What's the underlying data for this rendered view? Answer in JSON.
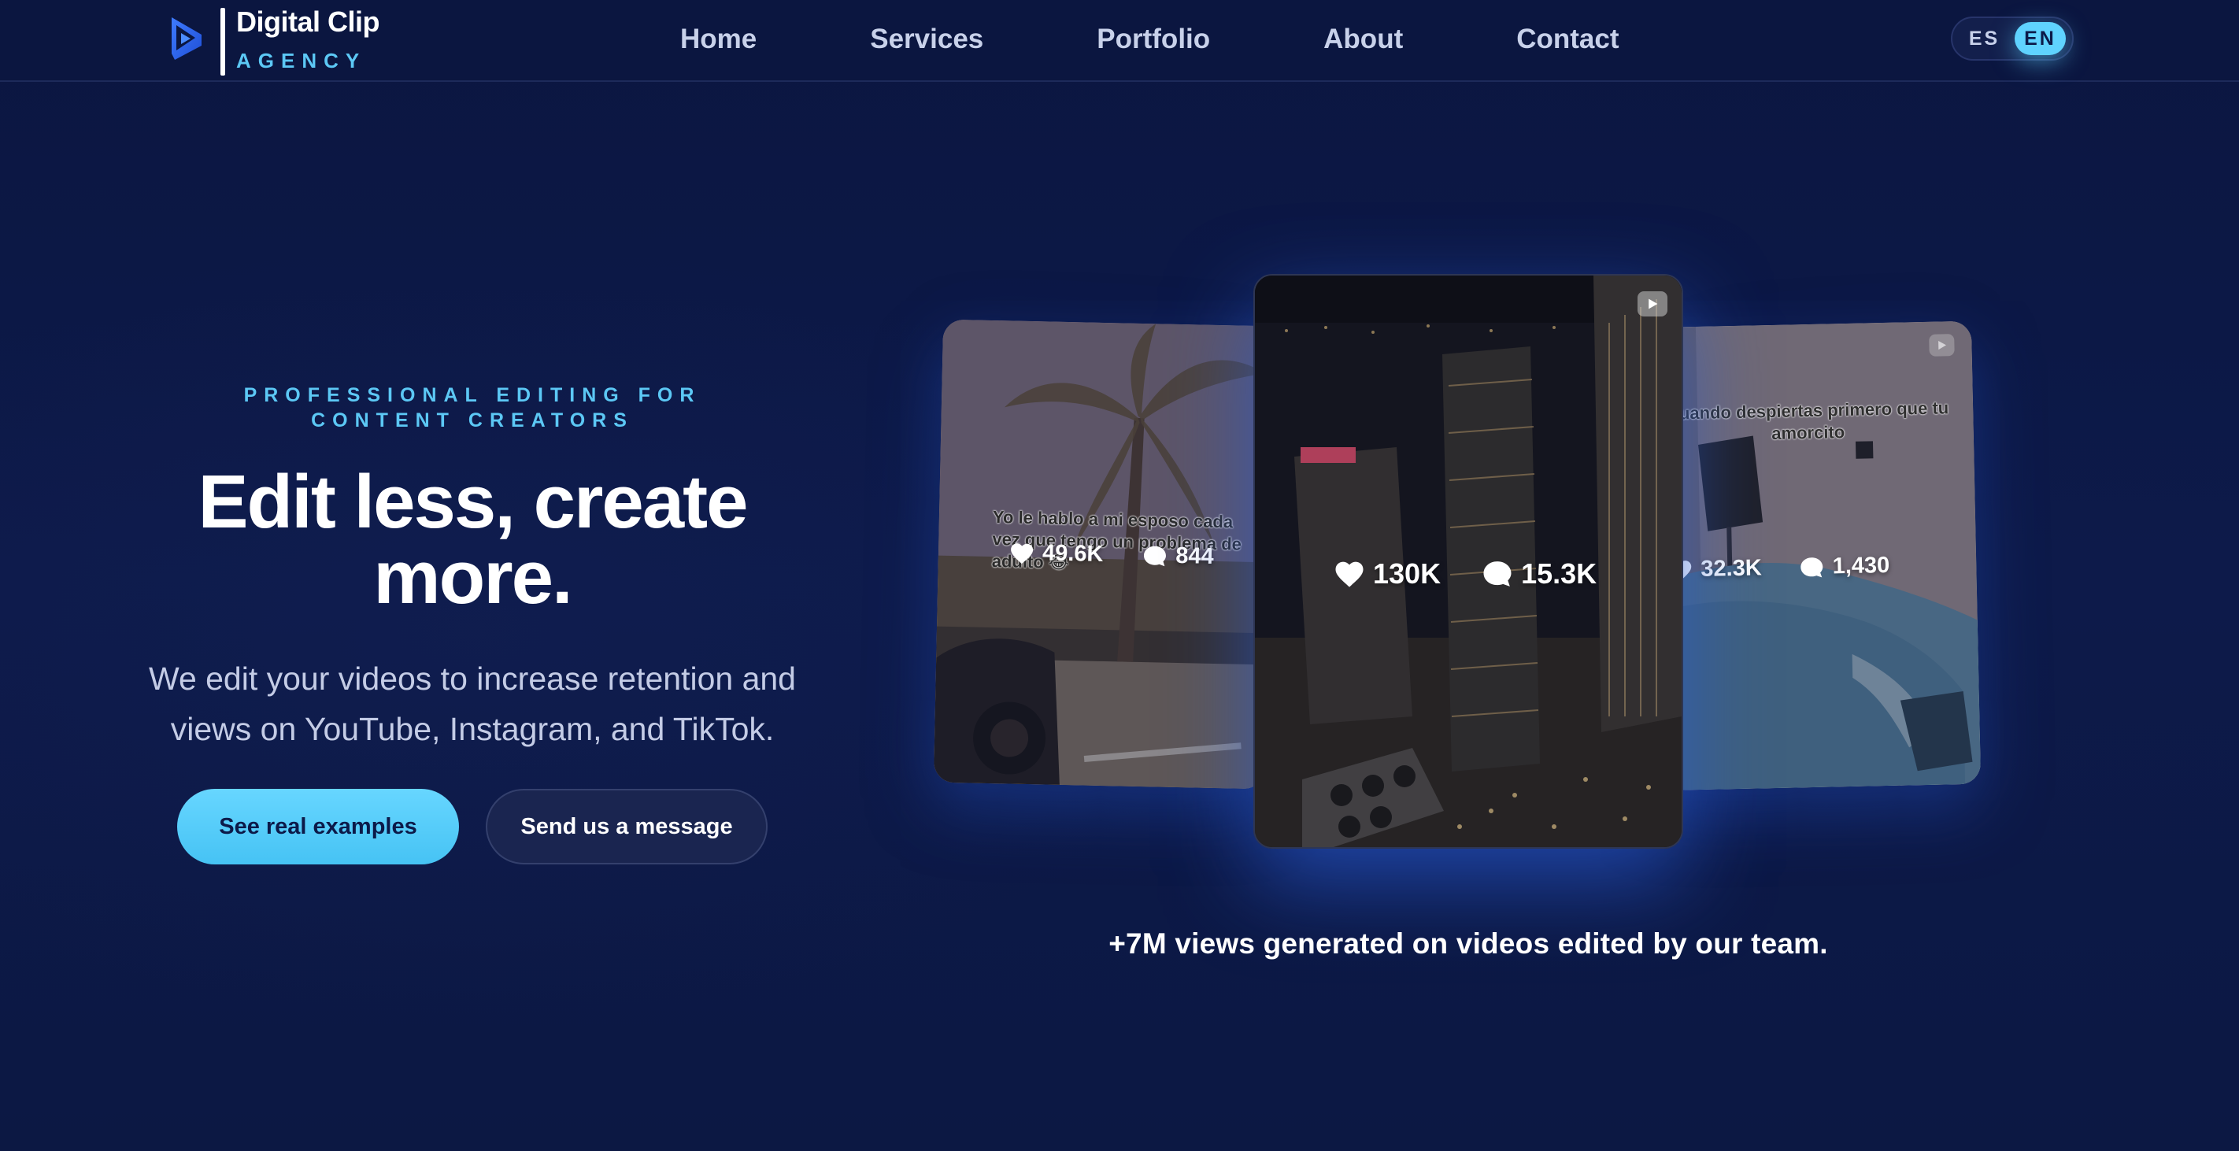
{
  "brand": {
    "name": "Digital Clip",
    "tagline": "AGENCY",
    "icon": "play-triangle-logo-icon"
  },
  "nav": {
    "items": [
      {
        "label": "Home"
      },
      {
        "label": "Services"
      },
      {
        "label": "Portfolio"
      },
      {
        "label": "About"
      },
      {
        "label": "Contact"
      }
    ]
  },
  "language": {
    "options": [
      "ES",
      "EN"
    ],
    "selected": "EN"
  },
  "hero": {
    "eyebrow": "PROFESSIONAL EDITING FOR CONTENT CREATORS",
    "headline": "Edit less, create more.",
    "subhead": "We edit your videos to increase retention and views on YouTube, Instagram, and TikTok.",
    "primary_cta": "See real examples",
    "secondary_cta": "Send us a message"
  },
  "videos": [
    {
      "position": "left",
      "caption": "Yo le hablo a mi esposo cada vez que tengo un problema de adulto 😂",
      "likes": "49.6K",
      "comments": "844"
    },
    {
      "position": "center",
      "caption": "",
      "likes": "130K",
      "comments": "15.3K"
    },
    {
      "position": "right",
      "caption": "Cuando despiertas primero que tu amorcito",
      "likes": "32.3K",
      "comments": "1,430"
    }
  ],
  "proof_text": "+7M views generated on videos edited by our team.",
  "colors": {
    "background": "#0c1740",
    "accent": "#5fd3ff",
    "eyebrow": "#5cc8f5",
    "nav_text": "#c8d1ea",
    "subhead_text": "#c4cce6"
  }
}
